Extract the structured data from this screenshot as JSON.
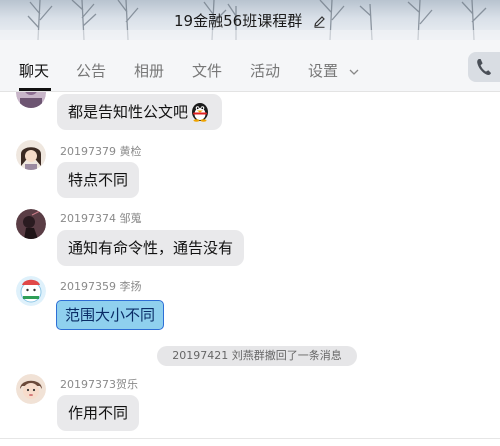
{
  "header": {
    "group_name": "19金融56班课程群"
  },
  "tabs": [
    {
      "label": "聊天",
      "active": true
    },
    {
      "label": "公告"
    },
    {
      "label": "相册"
    },
    {
      "label": "文件"
    },
    {
      "label": "活动"
    },
    {
      "label": "设置"
    }
  ],
  "messages": [
    {
      "sender": "",
      "text": "都是告知性公文吧",
      "emoji": "penguin-emoji"
    },
    {
      "sender": "20197379 黄检",
      "text": "特点不同"
    },
    {
      "sender": "20197374 邹蒐",
      "text": "通知有命令性，通告没有"
    },
    {
      "sender": "20197359 李扬",
      "text": "范围大小不同",
      "selected": true
    },
    {
      "sender": "20197373贺乐",
      "text": "作用不同"
    }
  ],
  "system_notice": "20197421 刘燕群撤回了一条消息",
  "colors": {
    "bubble": "#e9e9eb",
    "selection_fill": "#8fd0ee",
    "selection_border": "#2e6fd6"
  }
}
